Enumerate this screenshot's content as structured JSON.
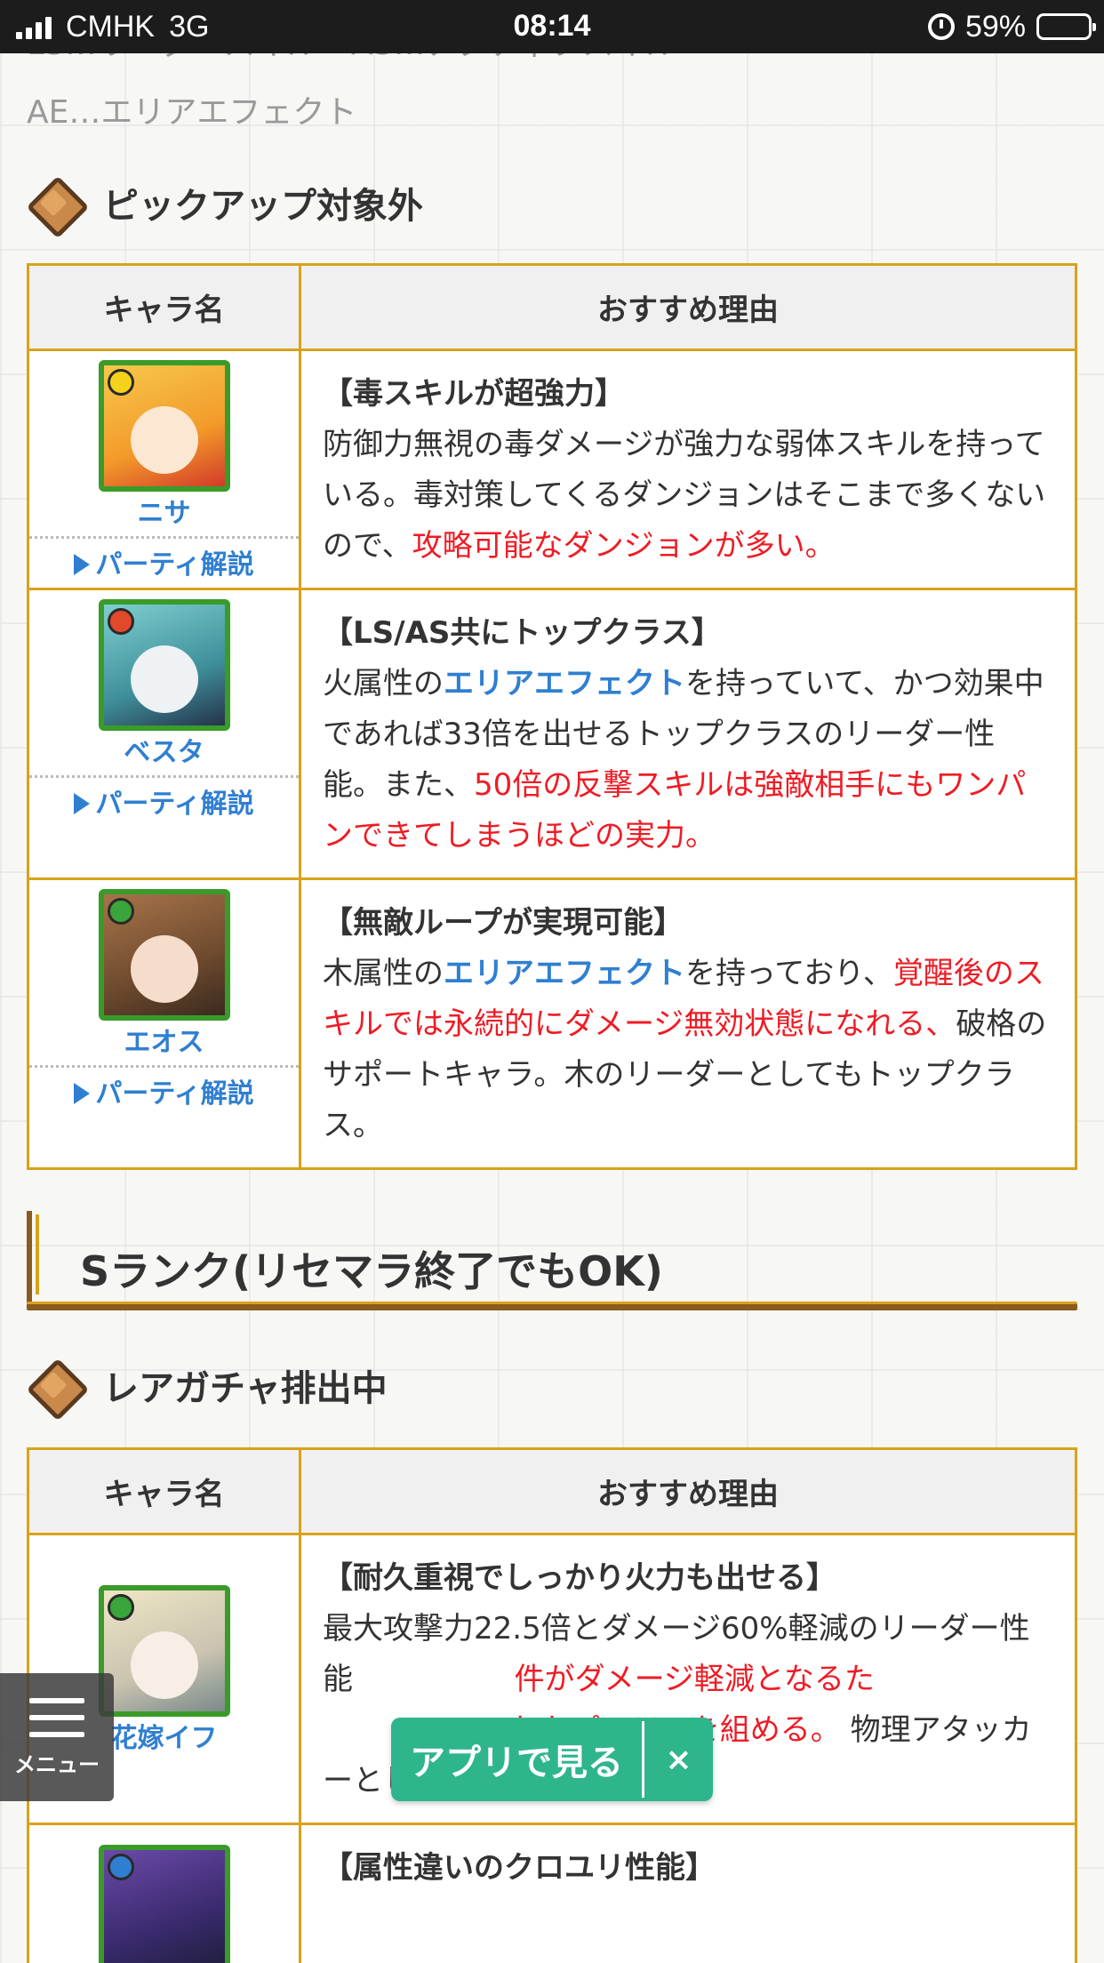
{
  "status_bar": {
    "carrier": "CMHK",
    "network": "3G",
    "time": "08:14",
    "battery": "59%"
  },
  "legend": {
    "line1": "LS…リーダースキル　AS…アクティブスキル",
    "line2": "AE…エリアエフェクト"
  },
  "section_pickup": {
    "heading": "ピックアップ対象外",
    "headers": [
      "キャラ名",
      "おすすめ理由"
    ],
    "rows": [
      {
        "name": "ニサ",
        "party_link": "パーティ解説",
        "title": "【毒スキルが超強力】",
        "text1": "防御力無視の毒ダメージが強力な弱体スキルを持っている。毒対策してくるダンジョンはそこまで多くないので、",
        "red1": "攻略可能なダンジョンが多い。"
      },
      {
        "name": "ベスタ",
        "party_link": "パーティ解説",
        "title": "【LS/AS共にトップクラス】",
        "text1": "火属性の",
        "blue1": "エリアエフェクト",
        "text2": "を持っていて、かつ効果中であれば33倍を出せるトップクラスのリーダー性能。また、",
        "red1": "50倍の反撃スキルは強敵相手にもワンパンできてしまうほどの実力。"
      },
      {
        "name": "エオス",
        "party_link": "パーティ解説",
        "title": "【無敵ループが実現可能】",
        "text1": "木属性の",
        "blue1": "エリアエフェクト",
        "text2": "を持っており、",
        "red1": "覚醒後のスキルでは永続的にダメージ無効状態になれる、",
        "text3": "破格のサポートキャラ。木のリーダーとしてもトップクラス。"
      }
    ]
  },
  "section_s": {
    "heading": "Sランク(リセマラ終了でもOK)"
  },
  "section_rare": {
    "heading": "レアガチャ排出中",
    "headers": [
      "キャラ名",
      "おすすめ理由"
    ],
    "rows": [
      {
        "name": "花嫁イフ",
        "title": "【耐久重視でしっかり火力も出せる】",
        "text1": "最大攻撃力22.5倍とダメージ60%軽減のリーダー性能",
        "red1": "件がダメージ軽減となるた",
        "red2": "れたパーティを組める。",
        "text2": "物理アタッカーとしても優秀。"
      },
      {
        "title": "【属性違いのクロユリ性能】"
      }
    ]
  },
  "menu": {
    "label": "メニュー"
  },
  "app_banner": {
    "label": "アプリで見る",
    "close": "×"
  },
  "colors": {
    "table_border": "#d9a21b",
    "link_blue": "#2f7fd1",
    "emphasis_red": "#ee1c25",
    "app_green": "#2fb58c"
  }
}
